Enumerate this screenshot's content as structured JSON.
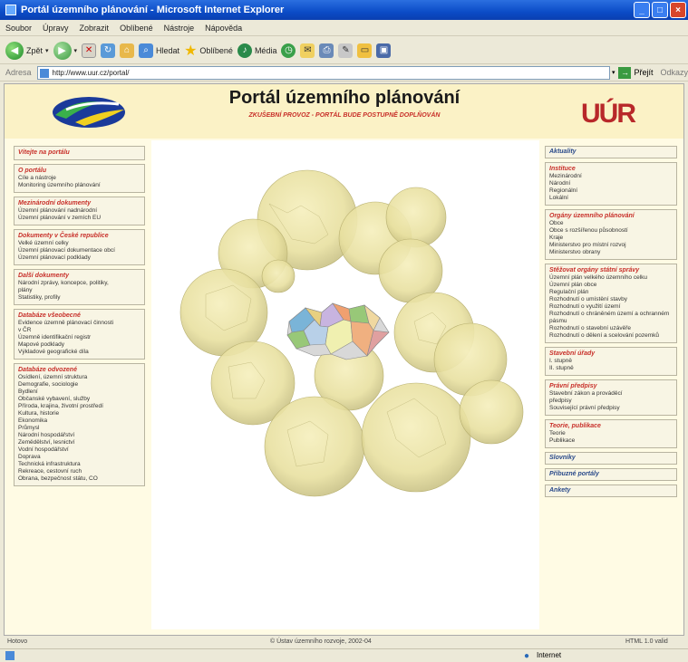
{
  "window": {
    "title": "Portál územního plánování - Microsoft Internet Explorer",
    "min_label": "_",
    "max_label": "□",
    "close_label": "×"
  },
  "menu": [
    "Soubor",
    "Úpravy",
    "Zobrazit",
    "Oblíbené",
    "Nástroje",
    "Nápověda"
  ],
  "toolbar": {
    "back_label": "Zpět",
    "search_label": "Hledat",
    "favorites_label": "Oblíbené",
    "media_label": "Média"
  },
  "address": {
    "label": "Adresa",
    "url": "http://www.uur.cz/portal/",
    "go_label": "Přejít",
    "links_label": "Odkazy"
  },
  "page": {
    "title": "Portál územního plánování",
    "subtitle": "ZKUŠEBNÍ PROVOZ - PORTÁL BUDE POSTUPNĚ DOPLŇOVÁN",
    "brand": "UÚR"
  },
  "left_boxes": [
    {
      "title": "Vítejte na portálu",
      "items": []
    },
    {
      "title": "O portálu",
      "items": [
        "Cíle a nástroje",
        "Monitoring územního plánování"
      ]
    },
    {
      "title": "Mezinárodní dokumenty",
      "items": [
        "Územní plánování nadnárodní",
        "Územní plánování v zemích EU"
      ]
    },
    {
      "title": "Dokumenty v České republice",
      "items": [
        "Velké územní celky",
        "Územní plánovací dokumentace obcí",
        "Územní plánovací podklady"
      ]
    },
    {
      "title": "Další dokumenty",
      "items": [
        "Národní zprávy, koncepce, politiky,",
        "plány",
        "Statistiky, profily"
      ]
    },
    {
      "title": "Databáze všeobecné",
      "items": [
        "Evidence územně plánovací činnosti",
        "v ČR",
        "Územně identifikační registr",
        "Mapové podklady",
        "Výkladové geografické díla"
      ]
    },
    {
      "title": "Databáze odvozené",
      "items": [
        "Osídlení, územní struktura",
        "Demografie, sociologie",
        "Bydlení",
        "Občanské vybavení, služby",
        "Příroda, krajina, životní prostředí",
        "Kultura, historie",
        "Ekonomika",
        "Průmysl",
        "Národní hospodářství",
        "Zemědělství, lesnictví",
        "Vodní hospodářství",
        "Doprava",
        "Technická infrastruktura",
        "Rekreace, cestovní ruch",
        "Obrana, bezpečnost státu, CO"
      ]
    }
  ],
  "right_boxes": [
    {
      "title": "Aktuality",
      "simple": true,
      "items": []
    },
    {
      "title": "Instituce",
      "items": [
        "Mezinárodní",
        "Národní",
        "Regionální",
        "Lokální"
      ]
    },
    {
      "title": "Orgány územního plánování",
      "items": [
        "Obce",
        "Obce s rozšířenou působností",
        "Kraje",
        "Ministerstvo pro místní rozvoj",
        "Ministerstvo obrany"
      ]
    },
    {
      "title": "Stěžovat orgány státní správy",
      "items": [
        "Územní plán velkého územního celku",
        "Územní plán obce",
        "Regulační plán",
        "Rozhodnutí o umístění stavby",
        "Rozhodnutí o využití území",
        "Rozhodnutí o chráněném území a ochranném pásmu",
        "Rozhodnutí o stavební uzávěře",
        "Rozhodnutí o dělení a scelování pozemků"
      ]
    },
    {
      "title": "Stavební úřady",
      "items": [
        "I. stupně",
        "II. stupně"
      ]
    },
    {
      "title": "Právní předpisy",
      "items": [
        "Stavební zákon a prováděcí",
        "předpisy",
        "Související právní předpisy"
      ]
    },
    {
      "title": "Teorie, publikace",
      "items": [
        "Teorie",
        "Publikace"
      ]
    },
    {
      "title": "Slovníky",
      "simple": true,
      "items": []
    },
    {
      "title": "Příbuzné portály",
      "simple": true,
      "items": []
    },
    {
      "title": "Ankety",
      "simple": true,
      "items": []
    }
  ],
  "footer": {
    "left": "Hotovo",
    "copyright": "© Ústav územního rozvoje, 2002-04",
    "right": "HTML 1.0 valid"
  },
  "statusbar": {
    "zone": "Internet"
  }
}
